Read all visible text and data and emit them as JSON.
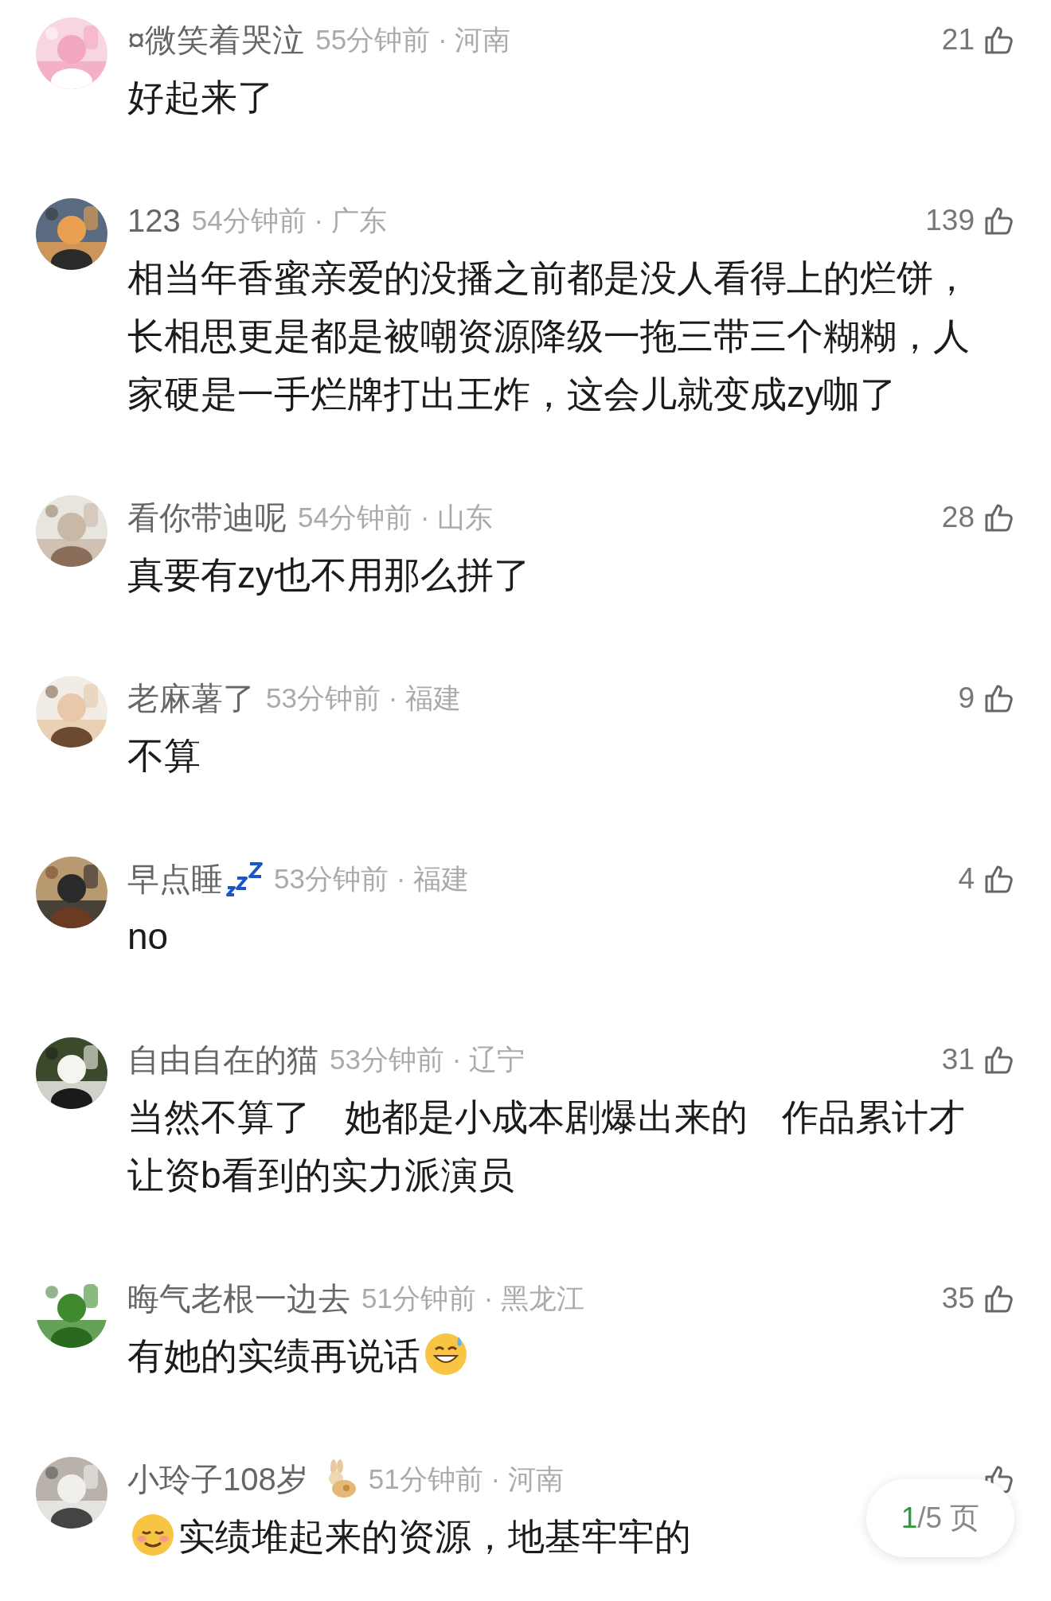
{
  "comments": [
    {
      "name": "¤微笑着哭泣",
      "meta": "55分钟前 · 河南",
      "likes": "21",
      "body": [
        {
          "kind": "text",
          "text": "好起来了"
        }
      ]
    },
    {
      "name": "123",
      "meta": "54分钟前 · 广东",
      "likes": "139",
      "body": [
        {
          "kind": "text",
          "text": "相当年香蜜亲爱的没播之前都是没人看得上的烂饼，长相思更是都是被嘲资源降级一拖三带三个糊糊，人家硬是一手烂牌打出王炸，这会儿就变成zy咖了"
        }
      ]
    },
    {
      "name": "看你带迪呢",
      "meta": "54分钟前 · 山东",
      "likes": "28",
      "body": [
        {
          "kind": "text",
          "text": "真要有zy也不用那么拼了"
        }
      ]
    },
    {
      "name": "老麻薯了",
      "meta": "53分钟前 · 福建",
      "likes": "9",
      "body": [
        {
          "kind": "text",
          "text": "不算"
        }
      ]
    },
    {
      "name": "早点睡",
      "kind": "sleep-badge",
      "meta": "53分钟前 · 福建",
      "likes": "4",
      "body": [
        {
          "kind": "text",
          "text": "no"
        }
      ]
    },
    {
      "name": "自由自在的猫",
      "meta": "53分钟前 · 辽宁",
      "likes": "31",
      "body": [
        {
          "kind": "text",
          "text": "当然不算了 她都是小成本剧爆出来的 作品累计才让资b看到的实力派演员"
        }
      ]
    },
    {
      "name": "晦气老根一边去",
      "meta": "51分钟前 · 黑龙江",
      "likes": "35",
      "body": [
        {
          "kind": "text",
          "text": "有她的实绩再说话"
        },
        {
          "kind": "sweat-emoji"
        }
      ]
    },
    {
      "name": "小玲子108岁",
      "kind": "rabbit-badge",
      "meta": "51分钟前 · 河南",
      "body": [
        {
          "kind": "smile-emoji"
        },
        {
          "kind": "text",
          "text": "实绩堆起来的资源，地基牢牢的"
        }
      ]
    }
  ],
  "pager": {
    "current": "1",
    "rest": "/5 页"
  }
}
